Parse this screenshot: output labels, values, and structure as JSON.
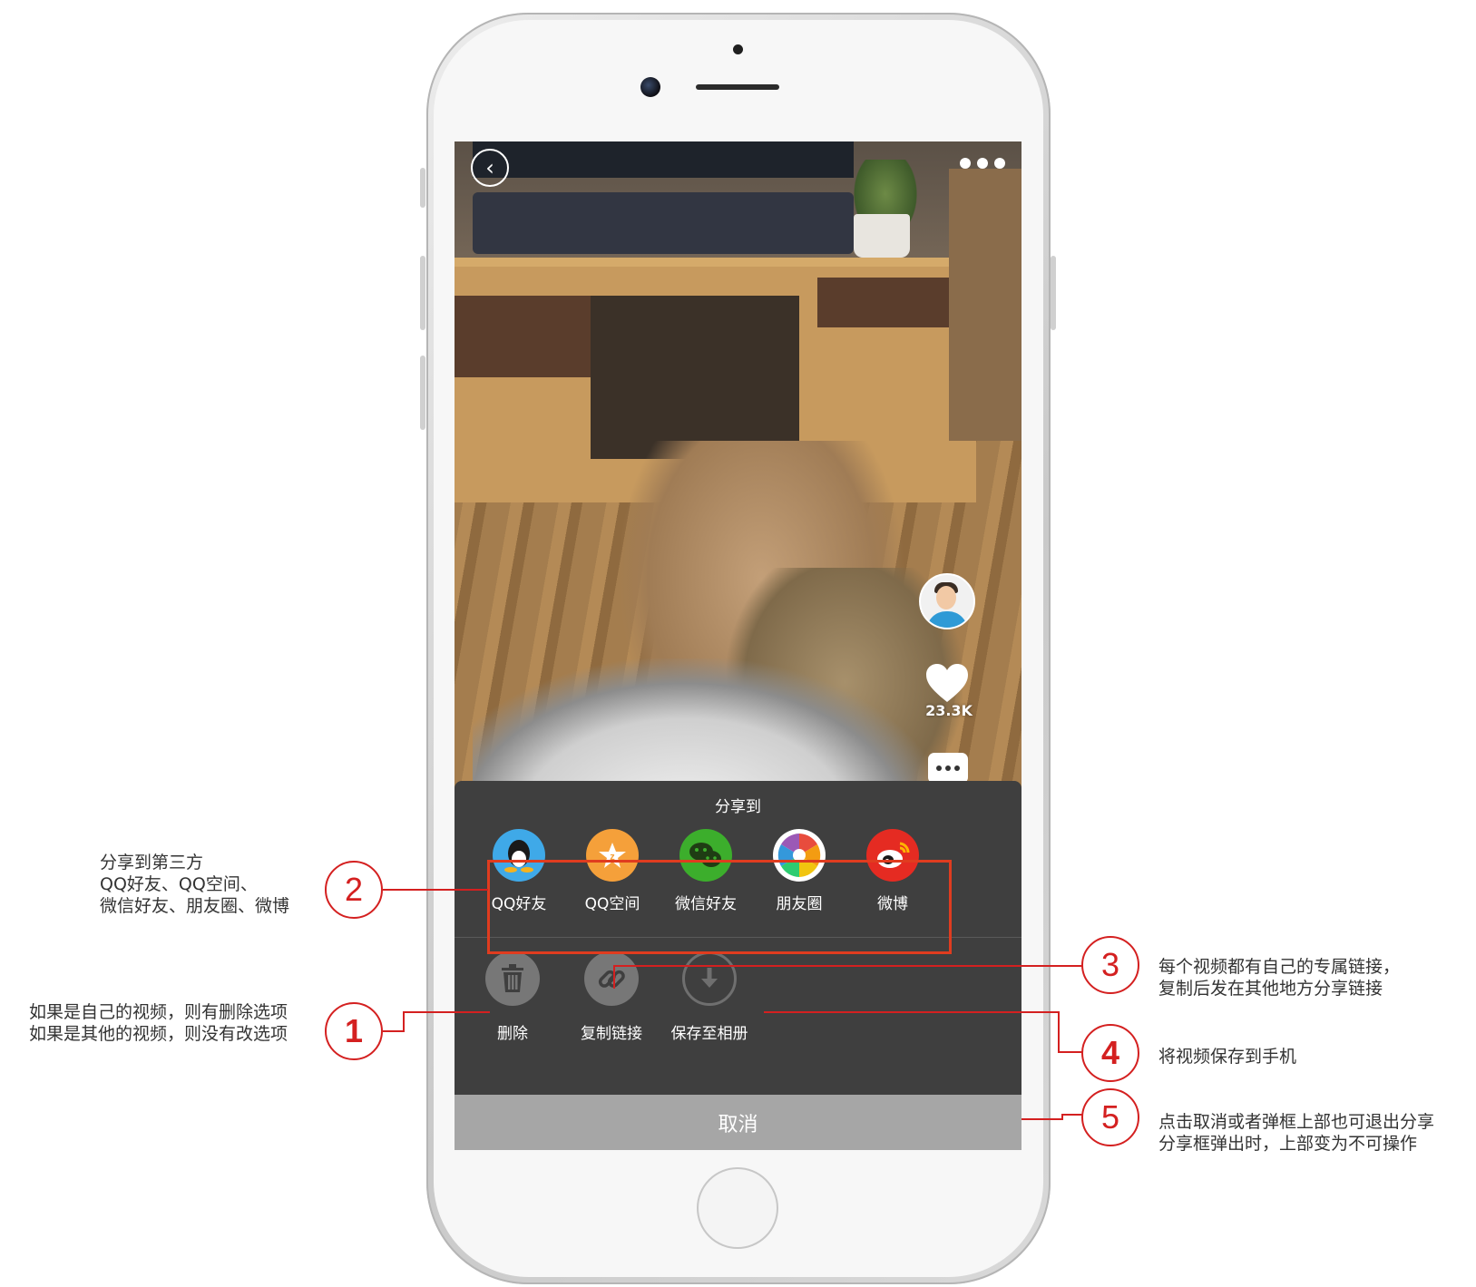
{
  "video": {
    "like_count": "23.3K"
  },
  "share_sheet": {
    "title": "分享到",
    "platforms": [
      {
        "label": "QQ好友",
        "icon": "qq-penguin-icon",
        "color": "#3fa9e8"
      },
      {
        "label": "QQ空间",
        "icon": "qzone-star-icon",
        "color": "#f5a03a"
      },
      {
        "label": "微信好友",
        "icon": "wechat-icon",
        "color": "#3cae2c"
      },
      {
        "label": "朋友圈",
        "icon": "moments-aperture-icon",
        "color": "#ffffff"
      },
      {
        "label": "微博",
        "icon": "weibo-icon",
        "color": "#e52b22"
      }
    ],
    "tools": [
      {
        "label": "删除",
        "icon": "trash-icon"
      },
      {
        "label": "复制链接",
        "icon": "link-icon"
      },
      {
        "label": "保存至相册",
        "icon": "download-icon"
      }
    ],
    "cancel_label": "取消"
  },
  "annotations": {
    "badge_1": "1",
    "badge_2": "2",
    "badge_3": "3",
    "badge_4": "4",
    "badge_5": "5",
    "note_2": [
      "分享到第三方",
      "QQ好友、QQ空间、",
      "微信好友、朋友圈、微博"
    ],
    "note_1": [
      "如果是自己的视频，则有删除选项",
      "如果是其他的视频，则没有改选项"
    ],
    "note_3": [
      "每个视频都有自己的专属链接，",
      "复制后发在其他地方分享链接"
    ],
    "note_4": [
      "将视频保存到手机"
    ],
    "note_5": [
      "点击取消或者弹框上部也可退出分享",
      "分享框弹出时，上部变为不可操作"
    ]
  },
  "colors": {
    "accent_red": "#d42020",
    "sheet_bg": "#3f3f3f",
    "cancel_bg": "#a6a6a6"
  }
}
